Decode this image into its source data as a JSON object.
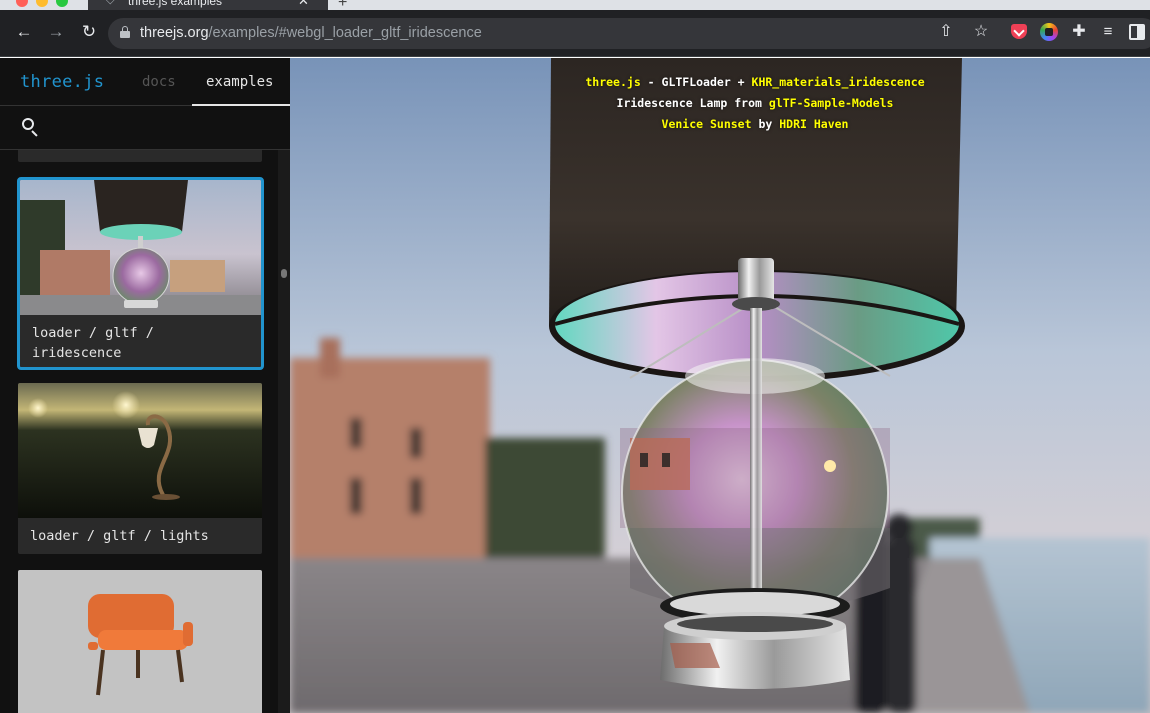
{
  "browser": {
    "tab_title": "three.js examples",
    "url_host": "threejs.org",
    "url_path": "/examples/#webgl_loader_gltf_iridescence"
  },
  "sidebar": {
    "logo": "three.js",
    "nav": {
      "docs": "docs",
      "examples": "examples"
    },
    "cards": [
      {
        "label_line1": "loader / gltf /",
        "label_line2": "iridescence",
        "selected": true
      },
      {
        "label": "loader / gltf / lights",
        "selected": false
      },
      {
        "label": "",
        "selected": false
      }
    ]
  },
  "viewer": {
    "info": {
      "line1_prefix": "three.js",
      "line1_mid": " - GLTFLoader + ",
      "line1_link": "KHR_materials_iridescence",
      "line2_prefix": "Iridescence Lamp from ",
      "line2_link": "glTF-Sample-Models",
      "line3_link1": "Venice Sunset",
      "line3_mid": " by ",
      "line3_link2": "HDRI Haven"
    }
  },
  "colors": {
    "accent": "#2194ce",
    "link_yellow": "#ffff00",
    "sidebar_bg": "#111111",
    "chrome_bg": "#202124"
  },
  "icons": [
    "back-icon",
    "forward-icon",
    "reload-icon",
    "lock-icon",
    "share-icon",
    "star-icon",
    "pocket-icon",
    "extension-ring-icon",
    "puzzle-icon",
    "media-icon",
    "side-panel-icon",
    "search-icon"
  ]
}
